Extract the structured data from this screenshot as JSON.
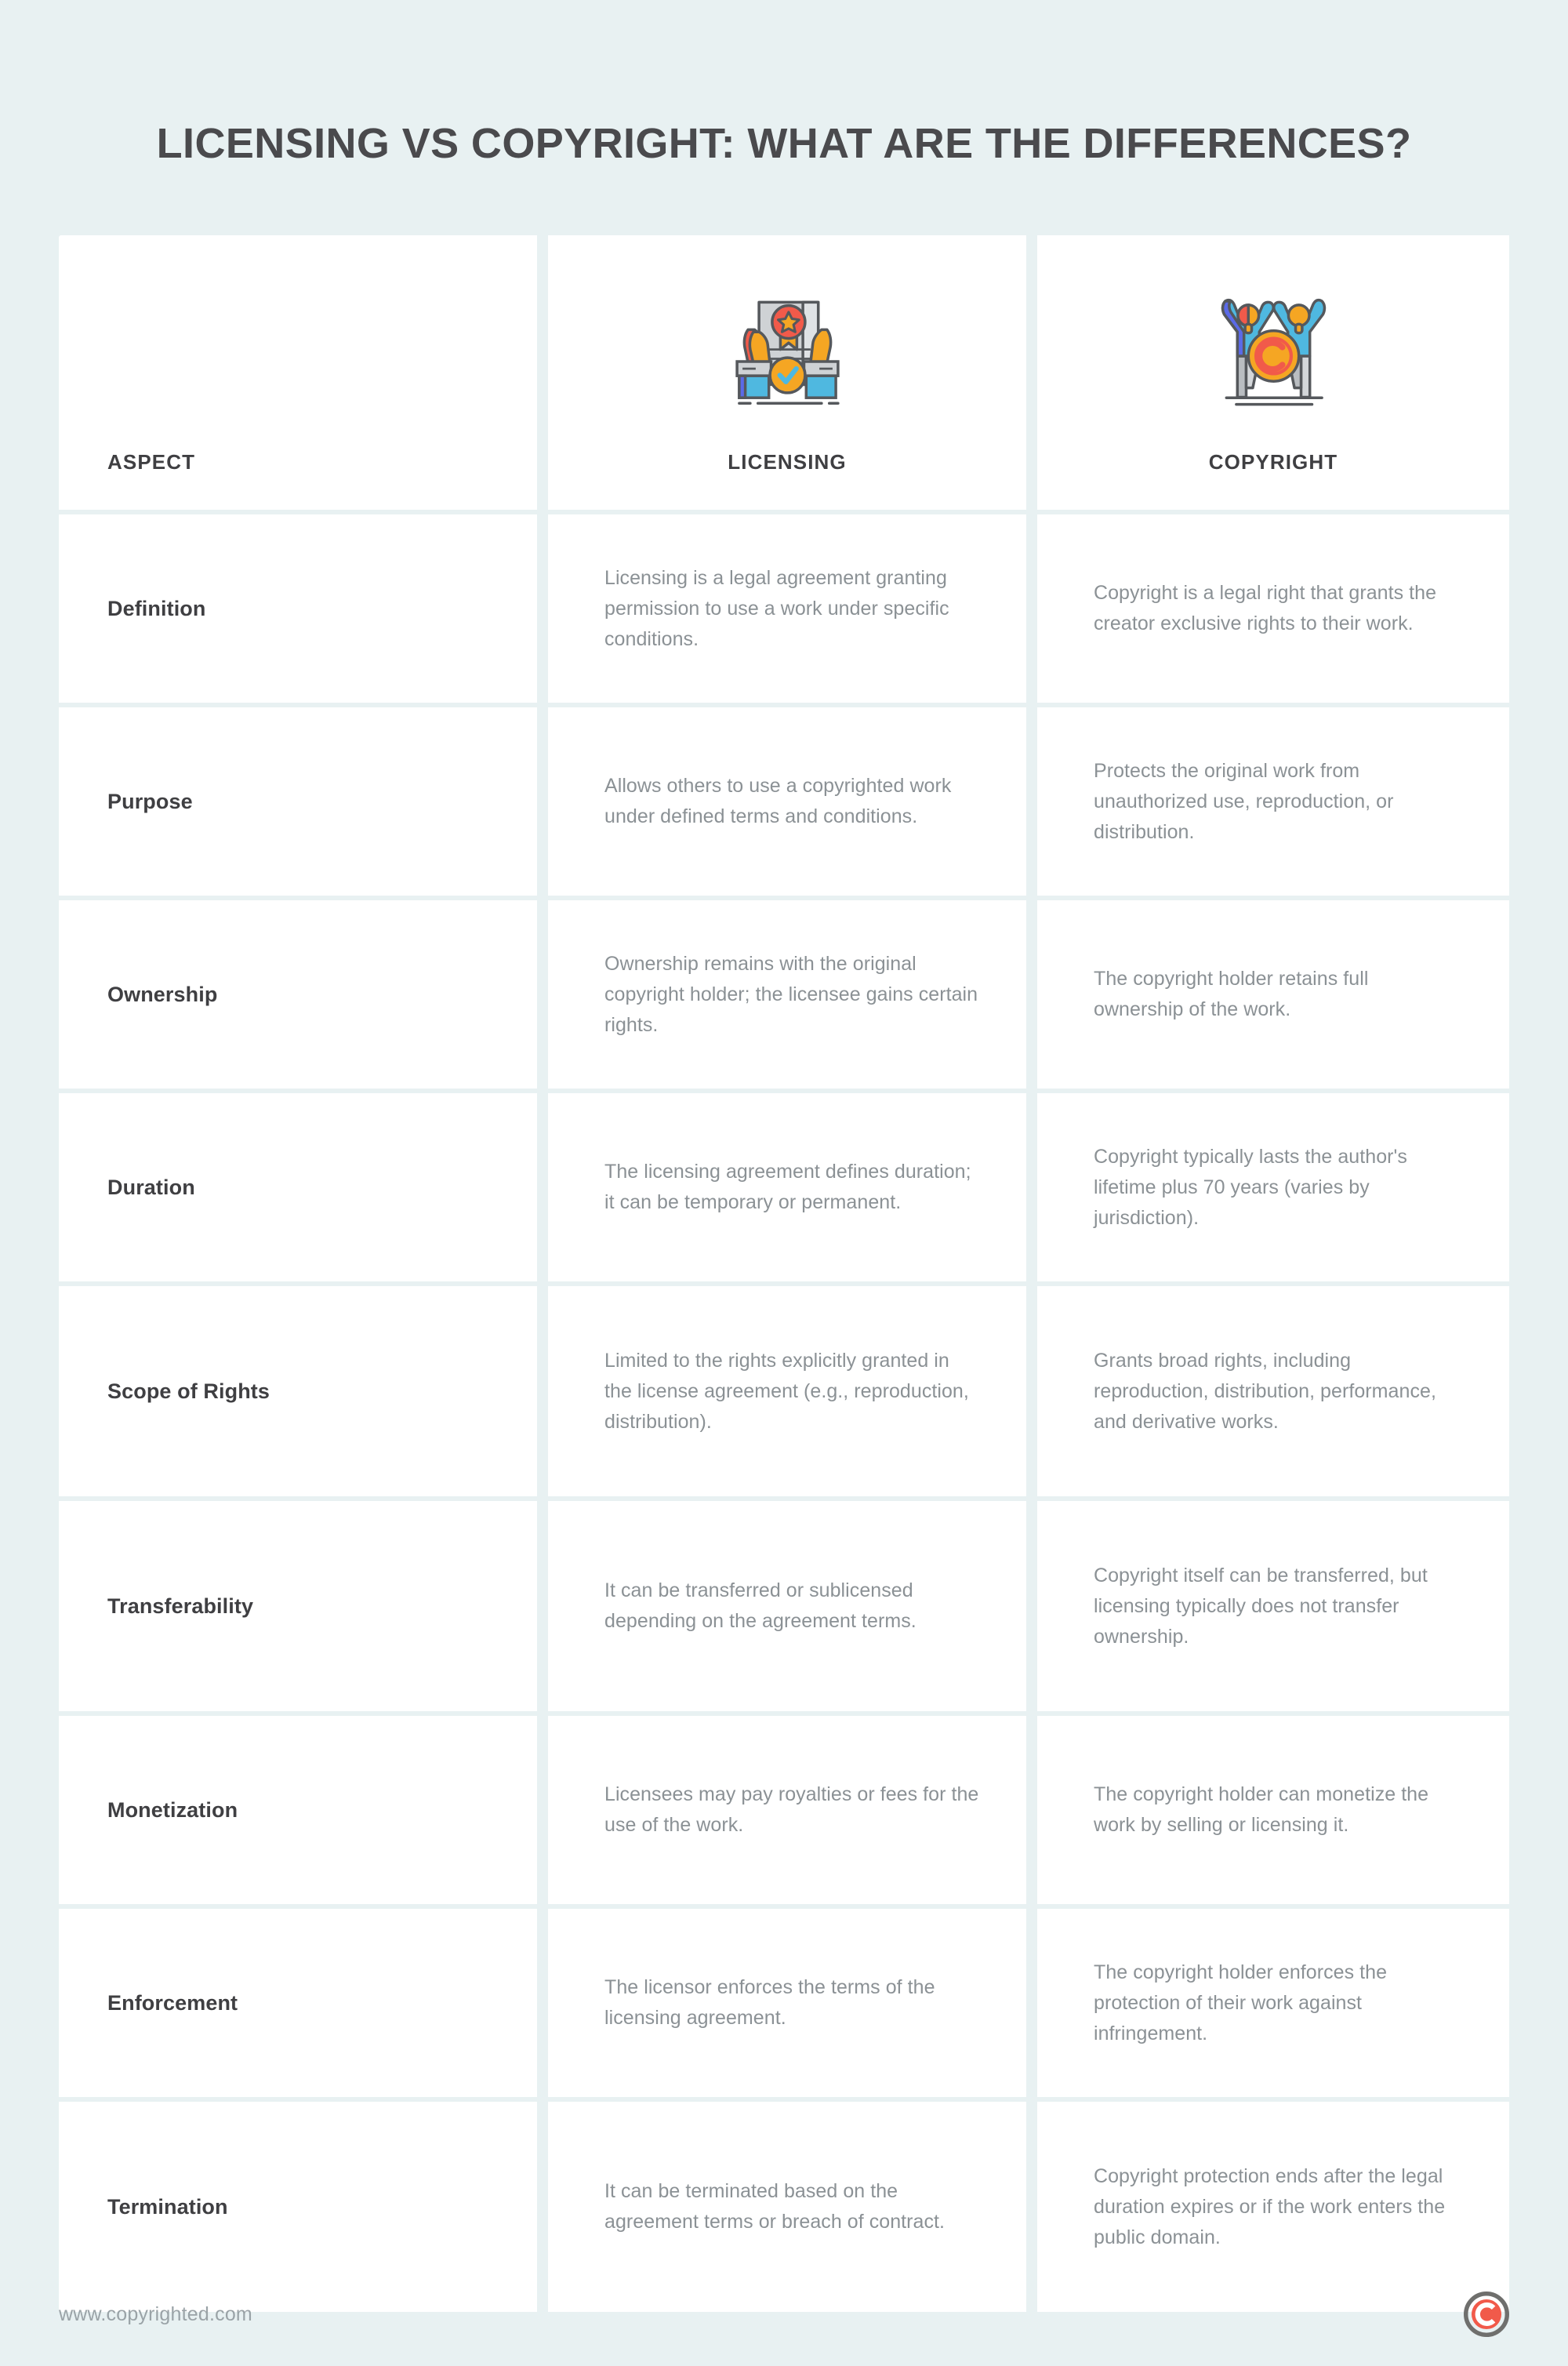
{
  "page": {
    "title": "Licensing vs Copyright: What Are the Differences?",
    "background_color": "#e8f1f2",
    "card_color": "#ffffff"
  },
  "colors": {
    "title_text": "#4a4a4d",
    "header_text": "#3f3f42",
    "body_text": "#8b9195",
    "footer_text": "#9aa3a7",
    "logo_red": "#f15a4a",
    "logo_gray": "#6f6f6d",
    "accent_yellow": "#f5a623",
    "accent_blue": "#4fb8e0",
    "accent_indigo": "#5b6ae8",
    "accent_red": "#f15a4a"
  },
  "table": {
    "headers": {
      "aspect": "ASPECT",
      "licensing": "LICENSING",
      "copyright": "COPYRIGHT"
    },
    "header_icons": {
      "licensing": "certificate-in-hands-icon",
      "copyright": "people-celebrating-copyright-icon"
    },
    "rows": [
      {
        "aspect": "Definition",
        "licensing": "Licensing is a legal agreement granting permission to use a work under specific conditions.",
        "copyright": "Copyright is a legal right that grants the creator exclusive rights to their work."
      },
      {
        "aspect": "Purpose",
        "licensing": "Allows others to use a copyrighted work under defined terms and conditions.",
        "copyright": "Protects the original work from unauthorized use, reproduction, or distribution."
      },
      {
        "aspect": "Ownership",
        "licensing": "Ownership remains with the original copyright holder; the licensee gains certain rights.",
        "copyright": "The copyright holder retains full ownership of the work."
      },
      {
        "aspect": "Duration",
        "licensing": "The licensing agreement defines duration; it can be temporary or permanent.",
        "copyright": "Copyright typically lasts the author's lifetime plus 70 years (varies by jurisdiction)."
      },
      {
        "aspect": "Scope of Rights",
        "licensing": "Limited to the rights explicitly granted in the license agreement (e.g., reproduction, distribution).",
        "copyright": "Grants broad rights, including reproduction, distribution, performance, and derivative works."
      },
      {
        "aspect": "Transferability",
        "licensing": "It can be transferred or sublicensed depending on the agreement terms.",
        "copyright": "Copyright itself can be transferred, but licensing typically does not transfer ownership."
      },
      {
        "aspect": "Monetization",
        "licensing": "Licensees may pay royalties or fees for the use of the work.",
        "copyright": "The copyright holder can monetize the work by selling or licensing it."
      },
      {
        "aspect": "Enforcement",
        "licensing": "The licensor enforces the terms of the licensing agreement.",
        "copyright": "The copyright holder enforces the protection of their work against infringement."
      },
      {
        "aspect": "Termination",
        "licensing": "It can be terminated based on the agreement terms or breach of contract.",
        "copyright": "Copyright protection ends after the legal duration expires or if the work enters the public domain."
      }
    ]
  },
  "footer": {
    "url": "www.copyrighted.com",
    "logo": "copyrighted-logo-icon"
  }
}
